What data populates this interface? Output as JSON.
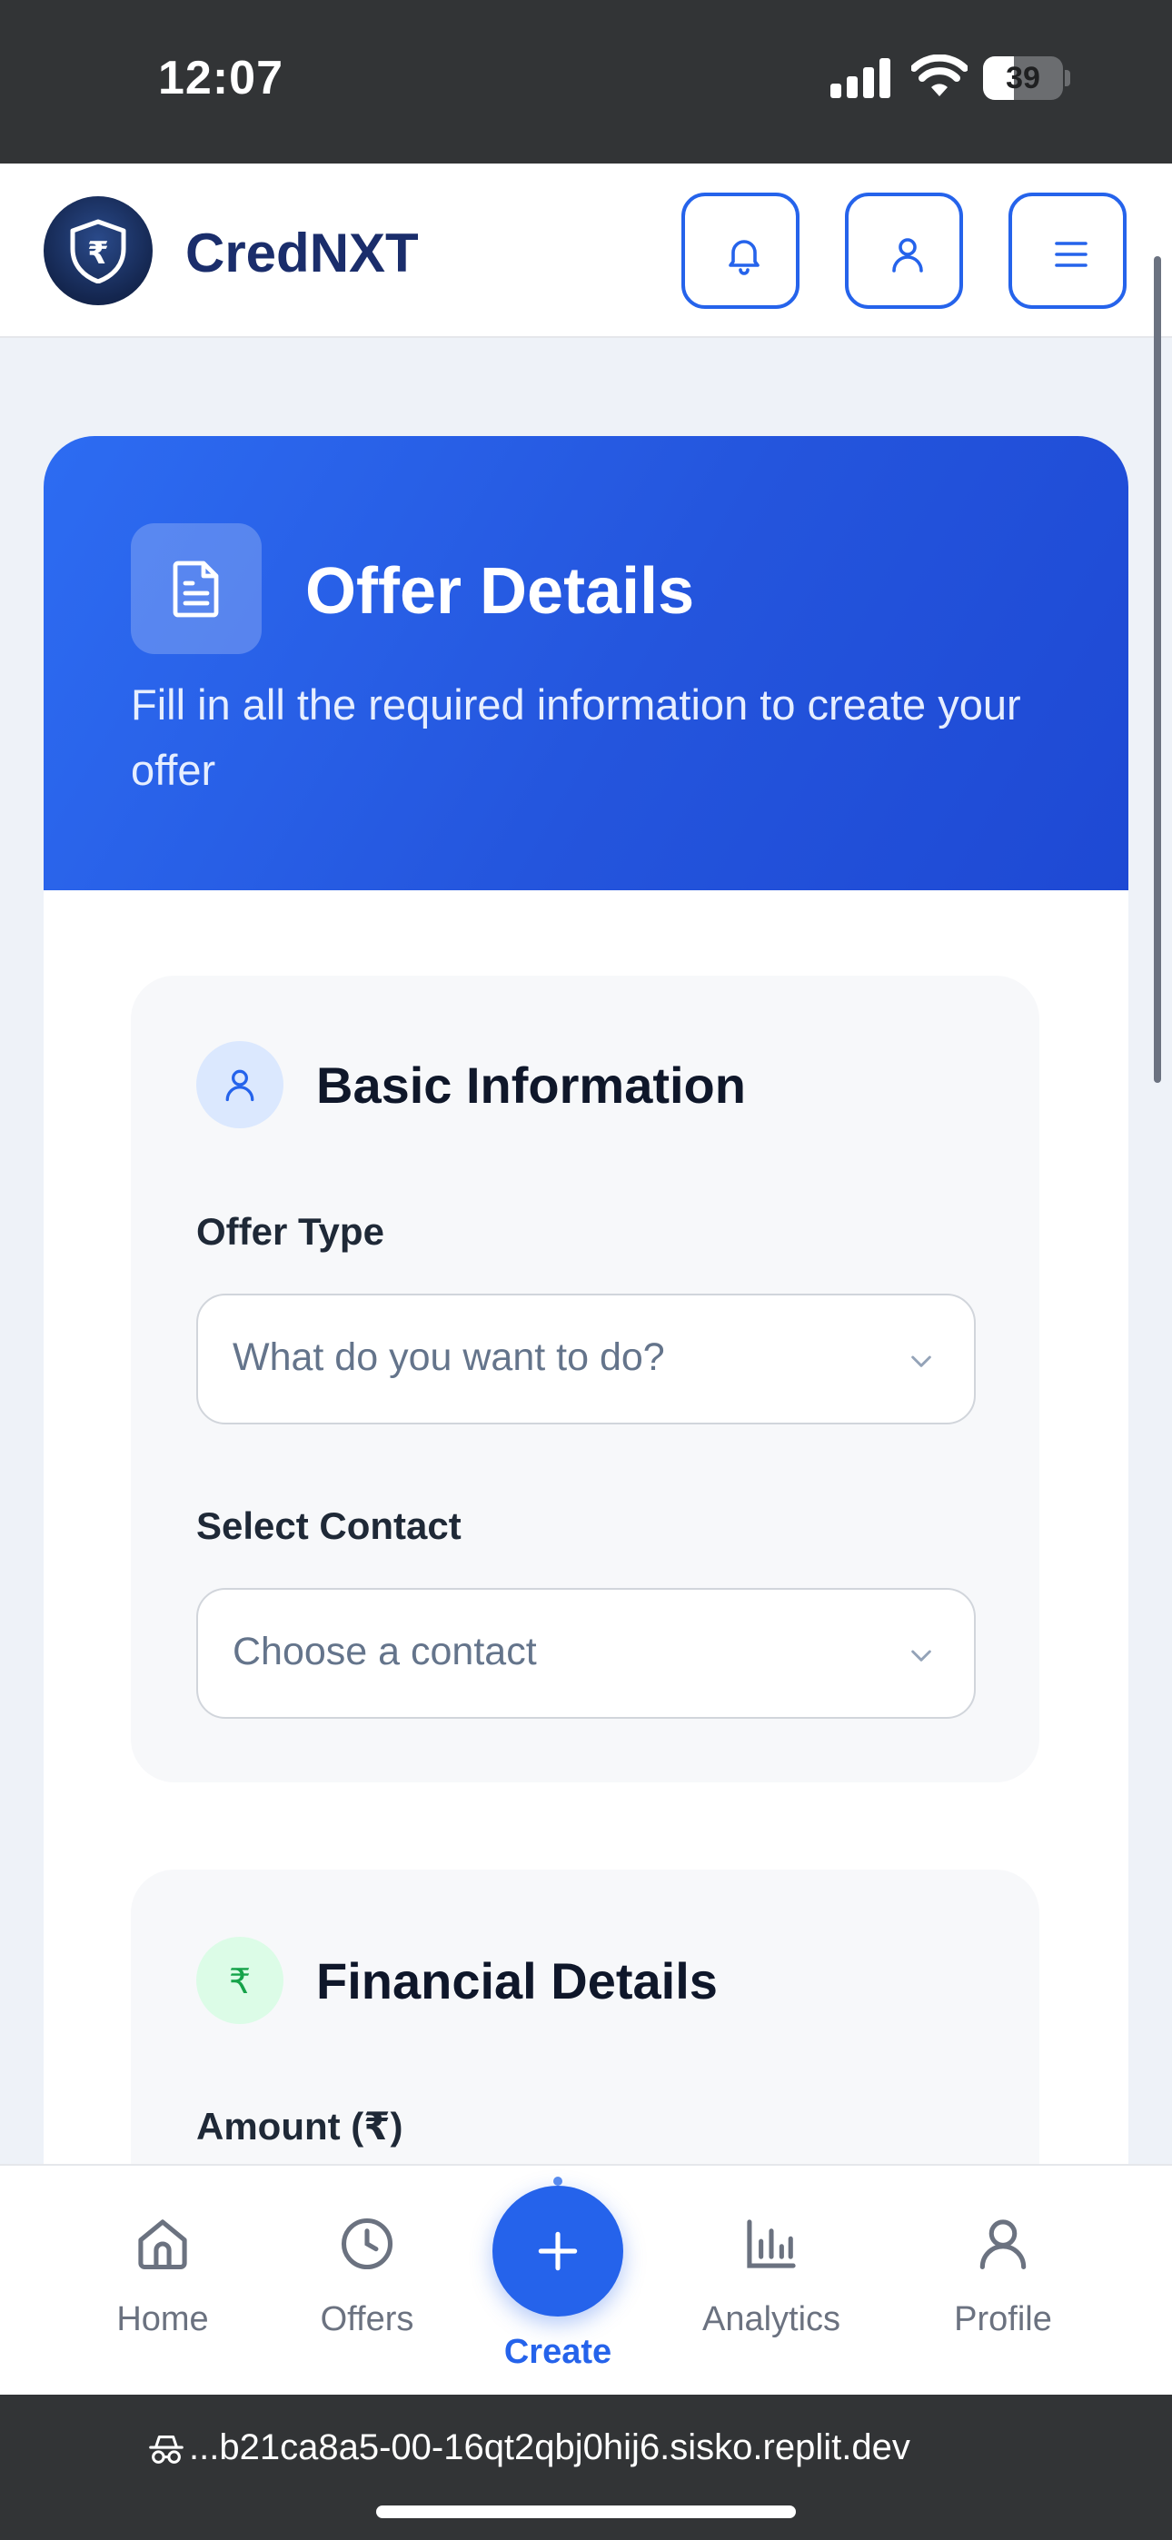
{
  "status_bar": {
    "time": "12:07",
    "battery": "39",
    "battery_level": 0.39
  },
  "header": {
    "brand": "CredNXT",
    "notifications_icon": "bell-icon",
    "account_icon": "user-icon",
    "menu_icon": "hamburger-menu-icon"
  },
  "hero": {
    "title": "Offer Details",
    "subtitle": "Fill in all the required information to create your offer",
    "icon": "document-icon"
  },
  "basic_info": {
    "title": "Basic Information",
    "offer_type_label": "Offer Type",
    "offer_type_placeholder": "What do you want to do?",
    "contact_label": "Select Contact",
    "contact_placeholder": "Choose a contact"
  },
  "financial": {
    "title": "Financial Details",
    "amount_label": "Amount (₹)"
  },
  "bottom_nav": {
    "home": "Home",
    "offers": "Offers",
    "create": "Create",
    "analytics": "Analytics",
    "profile": "Profile"
  },
  "browser": {
    "url": "...b21ca8a5-00-16qt2qbj0hij6.sisko.replit.dev"
  },
  "colors": {
    "primary": "#2563eb",
    "brand_text": "#1a2d6b",
    "status_bar_bg": "#323436",
    "rupee_green": "#16a34a"
  }
}
